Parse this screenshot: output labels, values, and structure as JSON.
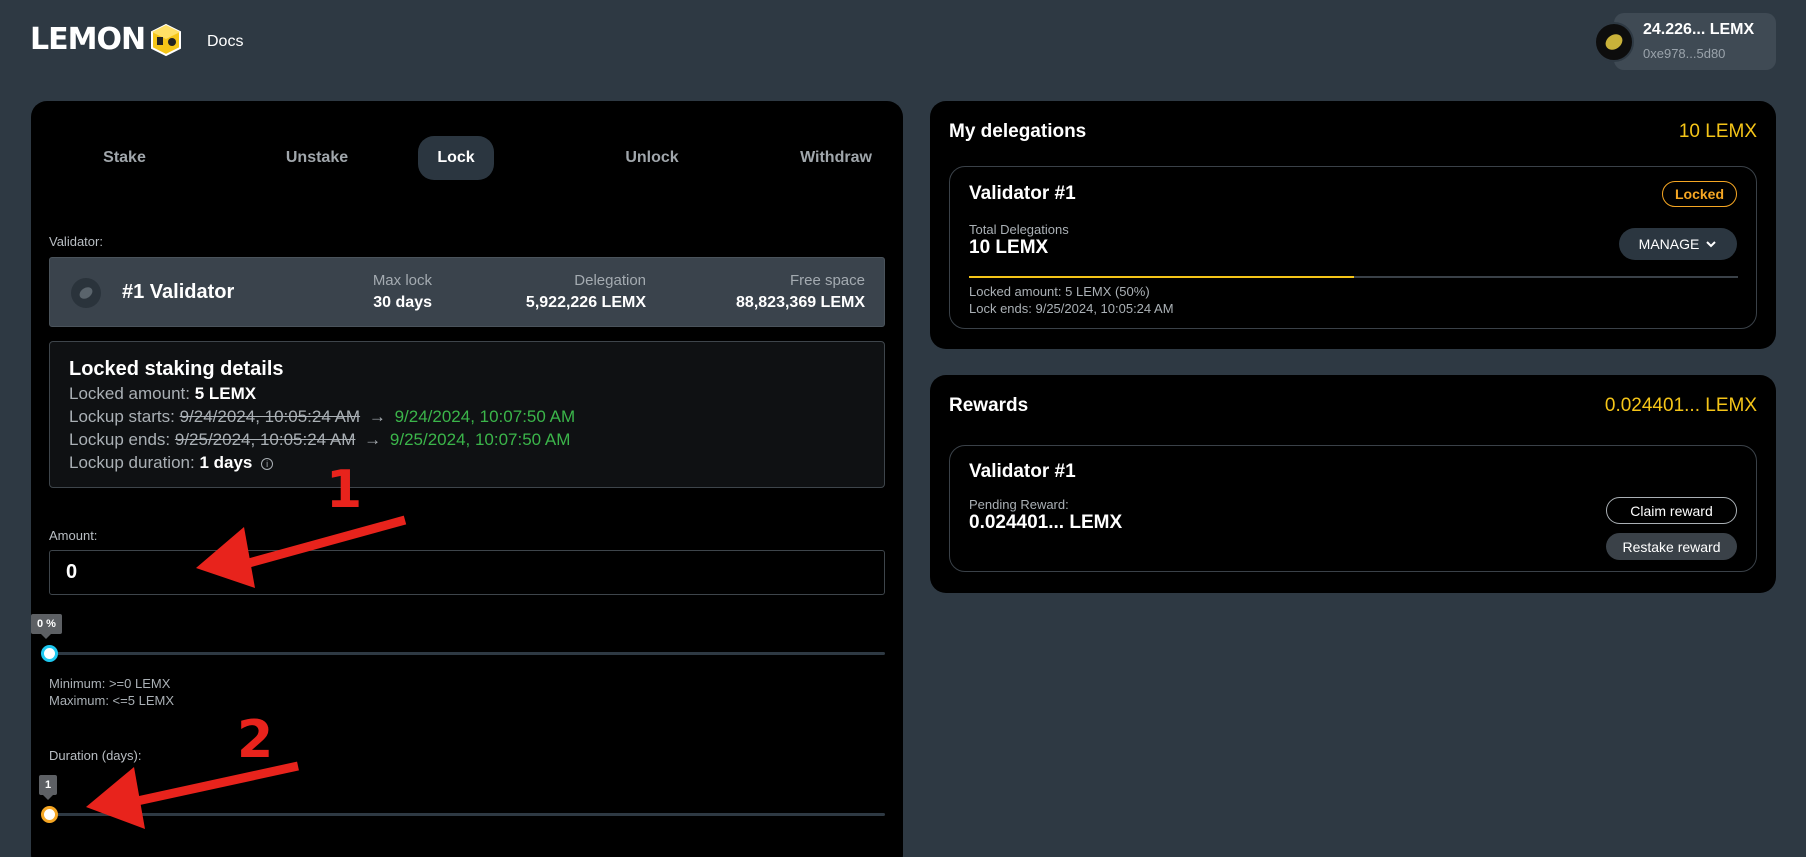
{
  "header": {
    "logo_text": "LEMON",
    "nav_docs": "Docs",
    "wallet_balance": "24.226... LEMX",
    "wallet_address": "0xe978...5d80"
  },
  "tabs": [
    {
      "label": "Stake",
      "active": false
    },
    {
      "label": "Unstake",
      "active": false
    },
    {
      "label": "Lock",
      "active": true
    },
    {
      "label": "Unlock",
      "active": false
    },
    {
      "label": "Withdraw",
      "active": false
    }
  ],
  "lock_form": {
    "validator_label": "Validator:",
    "validator": {
      "name": "#1 Validator",
      "max_lock_label": "Max lock",
      "max_lock_value": "30 days",
      "delegation_label": "Delegation",
      "delegation_value": "5,922,226 LEMX",
      "free_space_label": "Free space",
      "free_space_value": "88,823,369 LEMX"
    },
    "details": {
      "title": "Locked staking details",
      "locked_amount_label": "Locked amount:",
      "locked_amount_value": "5 LEMX",
      "lockup_starts_label": "Lockup starts:",
      "lockup_starts_old": "9/24/2024, 10:05:24 AM",
      "lockup_starts_new": "9/24/2024, 10:07:50 AM",
      "lockup_ends_label": "Lockup ends:",
      "lockup_ends_old": "9/25/2024, 10:05:24 AM",
      "lockup_ends_new": "9/25/2024, 10:07:50 AM",
      "lockup_duration_label": "Lockup duration:",
      "lockup_duration_value": "1 days"
    },
    "amount_label": "Amount:",
    "amount_value": "0",
    "amount_slider_tooltip": "0 %",
    "amount_percent": 0,
    "minimum_text": "Minimum: >=0 LEMX",
    "maximum_text": "Maximum: <=5 LEMX",
    "duration_label": "Duration (days):",
    "duration_tooltip": "1",
    "duration_value": 1
  },
  "delegations": {
    "title": "My delegations",
    "total": "10 LEMX",
    "card": {
      "validator": "Validator #1",
      "status": "Locked",
      "total_label": "Total Delegations",
      "total_value": "10 LEMX",
      "manage_label": "MANAGE",
      "locked_percent": 50,
      "locked_amount_text": "Locked amount: 5 LEMX (50%)",
      "lock_ends_text": "Lock ends: 9/25/2024, 10:05:24 AM"
    }
  },
  "rewards": {
    "title": "Rewards",
    "total": "0.024401... LEMX",
    "card": {
      "validator": "Validator #1",
      "pending_label": "Pending Reward:",
      "pending_value": "0.024401... LEMX",
      "claim_label": "Claim reward",
      "restake_label": "Restake reward"
    }
  },
  "annotations": {
    "marker_1": "1",
    "marker_2": "2"
  },
  "colors": {
    "background": "#2e3943",
    "panel": "#000000",
    "accent_yellow": "#f5c518",
    "locked_orange": "#f5a623",
    "green": "#3bb54a",
    "annotation_red": "#e8231c",
    "amount_thumb": "#1ec8f0",
    "duration_thumb": "#f5a623"
  }
}
